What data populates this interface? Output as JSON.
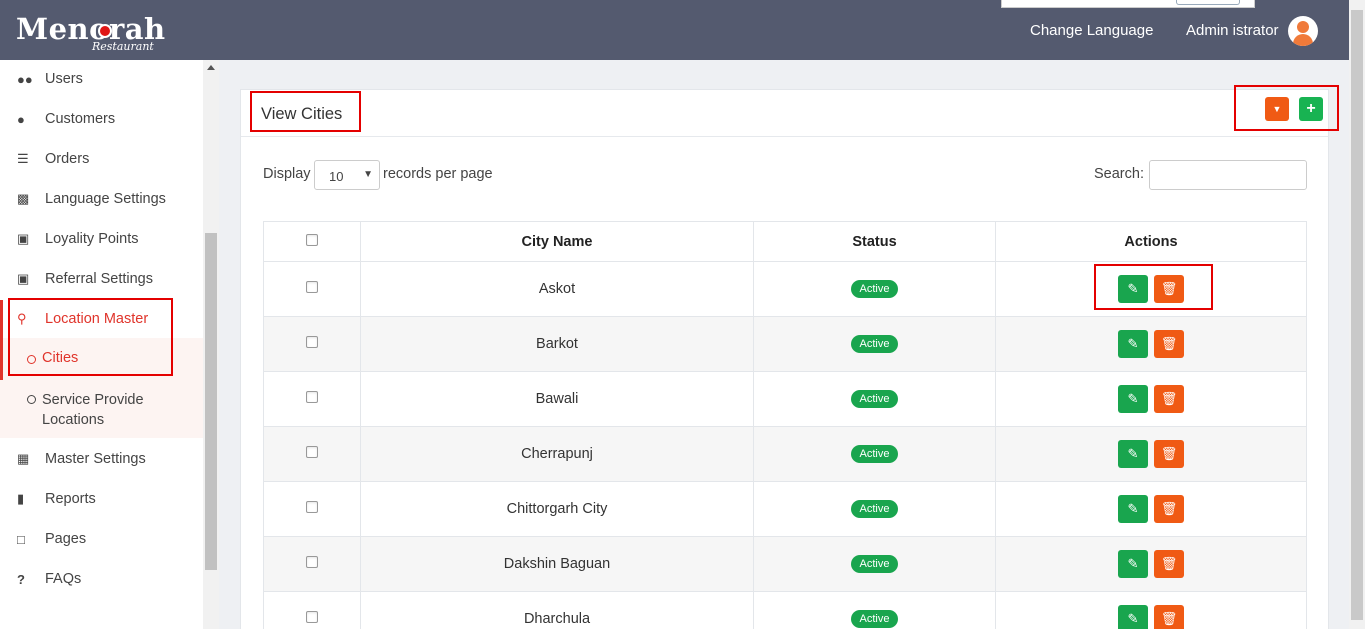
{
  "header": {
    "logo_text": "Menorah",
    "logo_subtext": "Restaurant",
    "change_language": "Change Language",
    "admin_name": "Admin istrator"
  },
  "sidebar": {
    "items": [
      {
        "label": "Users",
        "icon": "users-icon"
      },
      {
        "label": "Customers",
        "icon": "user-icon"
      },
      {
        "label": "Orders",
        "icon": "list-icon"
      },
      {
        "label": "Language Settings",
        "icon": "language-icon"
      },
      {
        "label": "Loyality Points",
        "icon": "gift-icon"
      },
      {
        "label": "Referral Settings",
        "icon": "gift-icon"
      },
      {
        "label": "Location Master",
        "icon": "map-marker-icon"
      },
      {
        "label": "Master Settings",
        "icon": "qrcode-icon"
      },
      {
        "label": "Reports",
        "icon": "bar-chart-icon"
      },
      {
        "label": "Pages",
        "icon": "square-icon"
      },
      {
        "label": "FAQs",
        "icon": "question-icon"
      }
    ],
    "subitems": [
      {
        "label": "Cities"
      },
      {
        "label": "Service Provide Locations"
      }
    ]
  },
  "card": {
    "title": "View Cities",
    "display_label": "Display",
    "records_select": "10",
    "per_page_label": "records per page",
    "search_label": "Search:"
  },
  "table": {
    "headers": [
      "City Name",
      "Status",
      "Actions"
    ],
    "rows": [
      {
        "city": "Askot",
        "status": "Active"
      },
      {
        "city": "Barkot",
        "status": "Active"
      },
      {
        "city": "Bawali",
        "status": "Active"
      },
      {
        "city": "Cherrapunj",
        "status": "Active"
      },
      {
        "city": "Chittorgarh City",
        "status": "Active"
      },
      {
        "city": "Dakshin Baguan",
        "status": "Active"
      },
      {
        "city": "Dharchula",
        "status": "Active"
      }
    ]
  },
  "colors": {
    "header_bg": "#545a6f",
    "accent_red": "#e0342b",
    "green": "#19a54e",
    "orange": "#f05a14",
    "annotation_red": "#e40000"
  }
}
